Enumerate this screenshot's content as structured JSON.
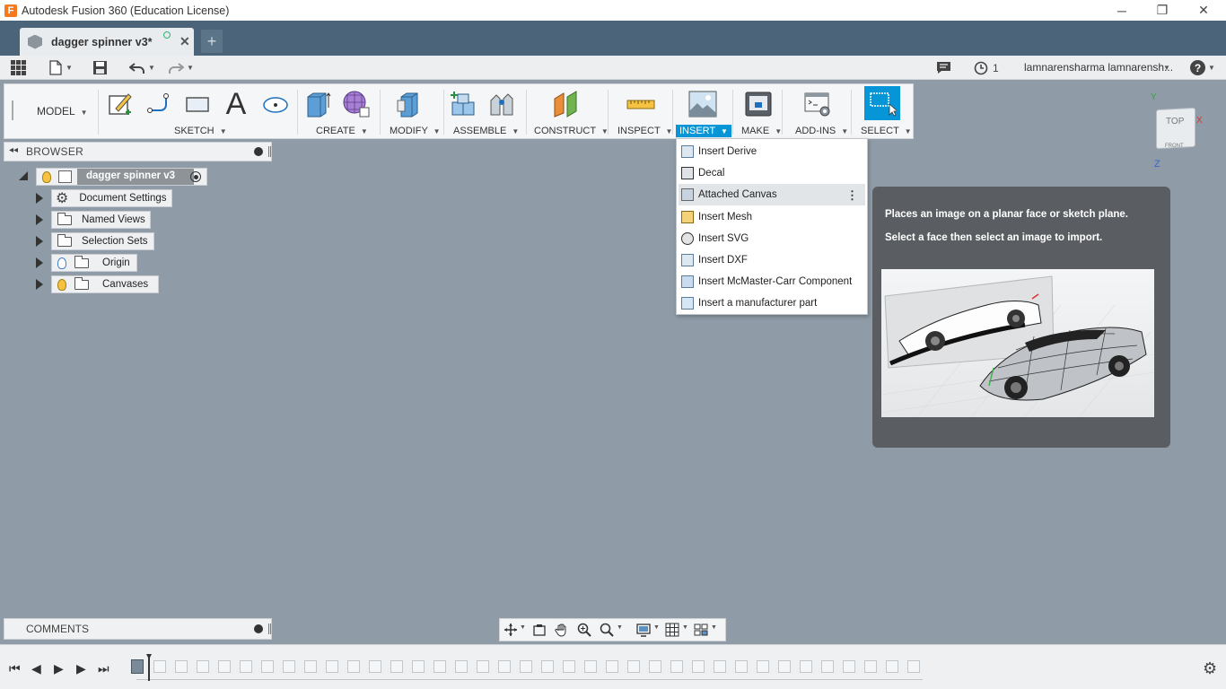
{
  "window": {
    "logo_letter": "F",
    "title": "Autodesk Fusion 360 (Education License)",
    "minimize": "─",
    "restore": "❐",
    "close": "✕"
  },
  "tabs": {
    "active_name": "dagger spinner v3*",
    "close": "✕",
    "new_tab": "+"
  },
  "quick_access": {
    "notifications_count": "1",
    "user_name": "lamnarensharma lamnarensh...",
    "help": "?"
  },
  "toolbar": {
    "workspace": "MODEL",
    "groups": [
      {
        "label": "SKETCH"
      },
      {
        "label": "CREATE"
      },
      {
        "label": "MODIFY"
      },
      {
        "label": "ASSEMBLE"
      },
      {
        "label": "CONSTRUCT"
      },
      {
        "label": "INSPECT"
      },
      {
        "label": "INSERT"
      },
      {
        "label": "MAKE"
      },
      {
        "label": "ADD-INS"
      },
      {
        "label": "SELECT"
      }
    ],
    "text_tool_glyph": "A"
  },
  "browser": {
    "title": "BROWSER",
    "root": "dagger spinner v3",
    "items": [
      {
        "label": "Document Settings"
      },
      {
        "label": "Named Views"
      },
      {
        "label": "Selection Sets"
      },
      {
        "label": "Origin"
      },
      {
        "label": "Canvases"
      }
    ]
  },
  "insert_menu": {
    "items": [
      {
        "label": "Insert Derive"
      },
      {
        "label": "Decal"
      },
      {
        "label": "Attached Canvas"
      },
      {
        "label": "Insert Mesh"
      },
      {
        "label": "Insert SVG"
      },
      {
        "label": "Insert DXF"
      },
      {
        "label": "Insert McMaster-Carr Component"
      },
      {
        "label": "Insert a manufacturer part"
      }
    ],
    "highlighted": "Attached Canvas"
  },
  "tooltip": {
    "line1": "Places an image on a planar face or sketch plane.",
    "line2": "Select a face then select an image to import."
  },
  "viewcube": {
    "top": "TOP",
    "front": "FRONT",
    "axis_x": "X",
    "axis_y": "Y",
    "axis_z": "Z"
  },
  "comments": {
    "title": "COMMENTS"
  },
  "colors": {
    "accent": "#0696d7",
    "canvas": "#8f9ba6",
    "tab_strip": "#4b6479",
    "tooltip_bg": "#5a5e62"
  }
}
